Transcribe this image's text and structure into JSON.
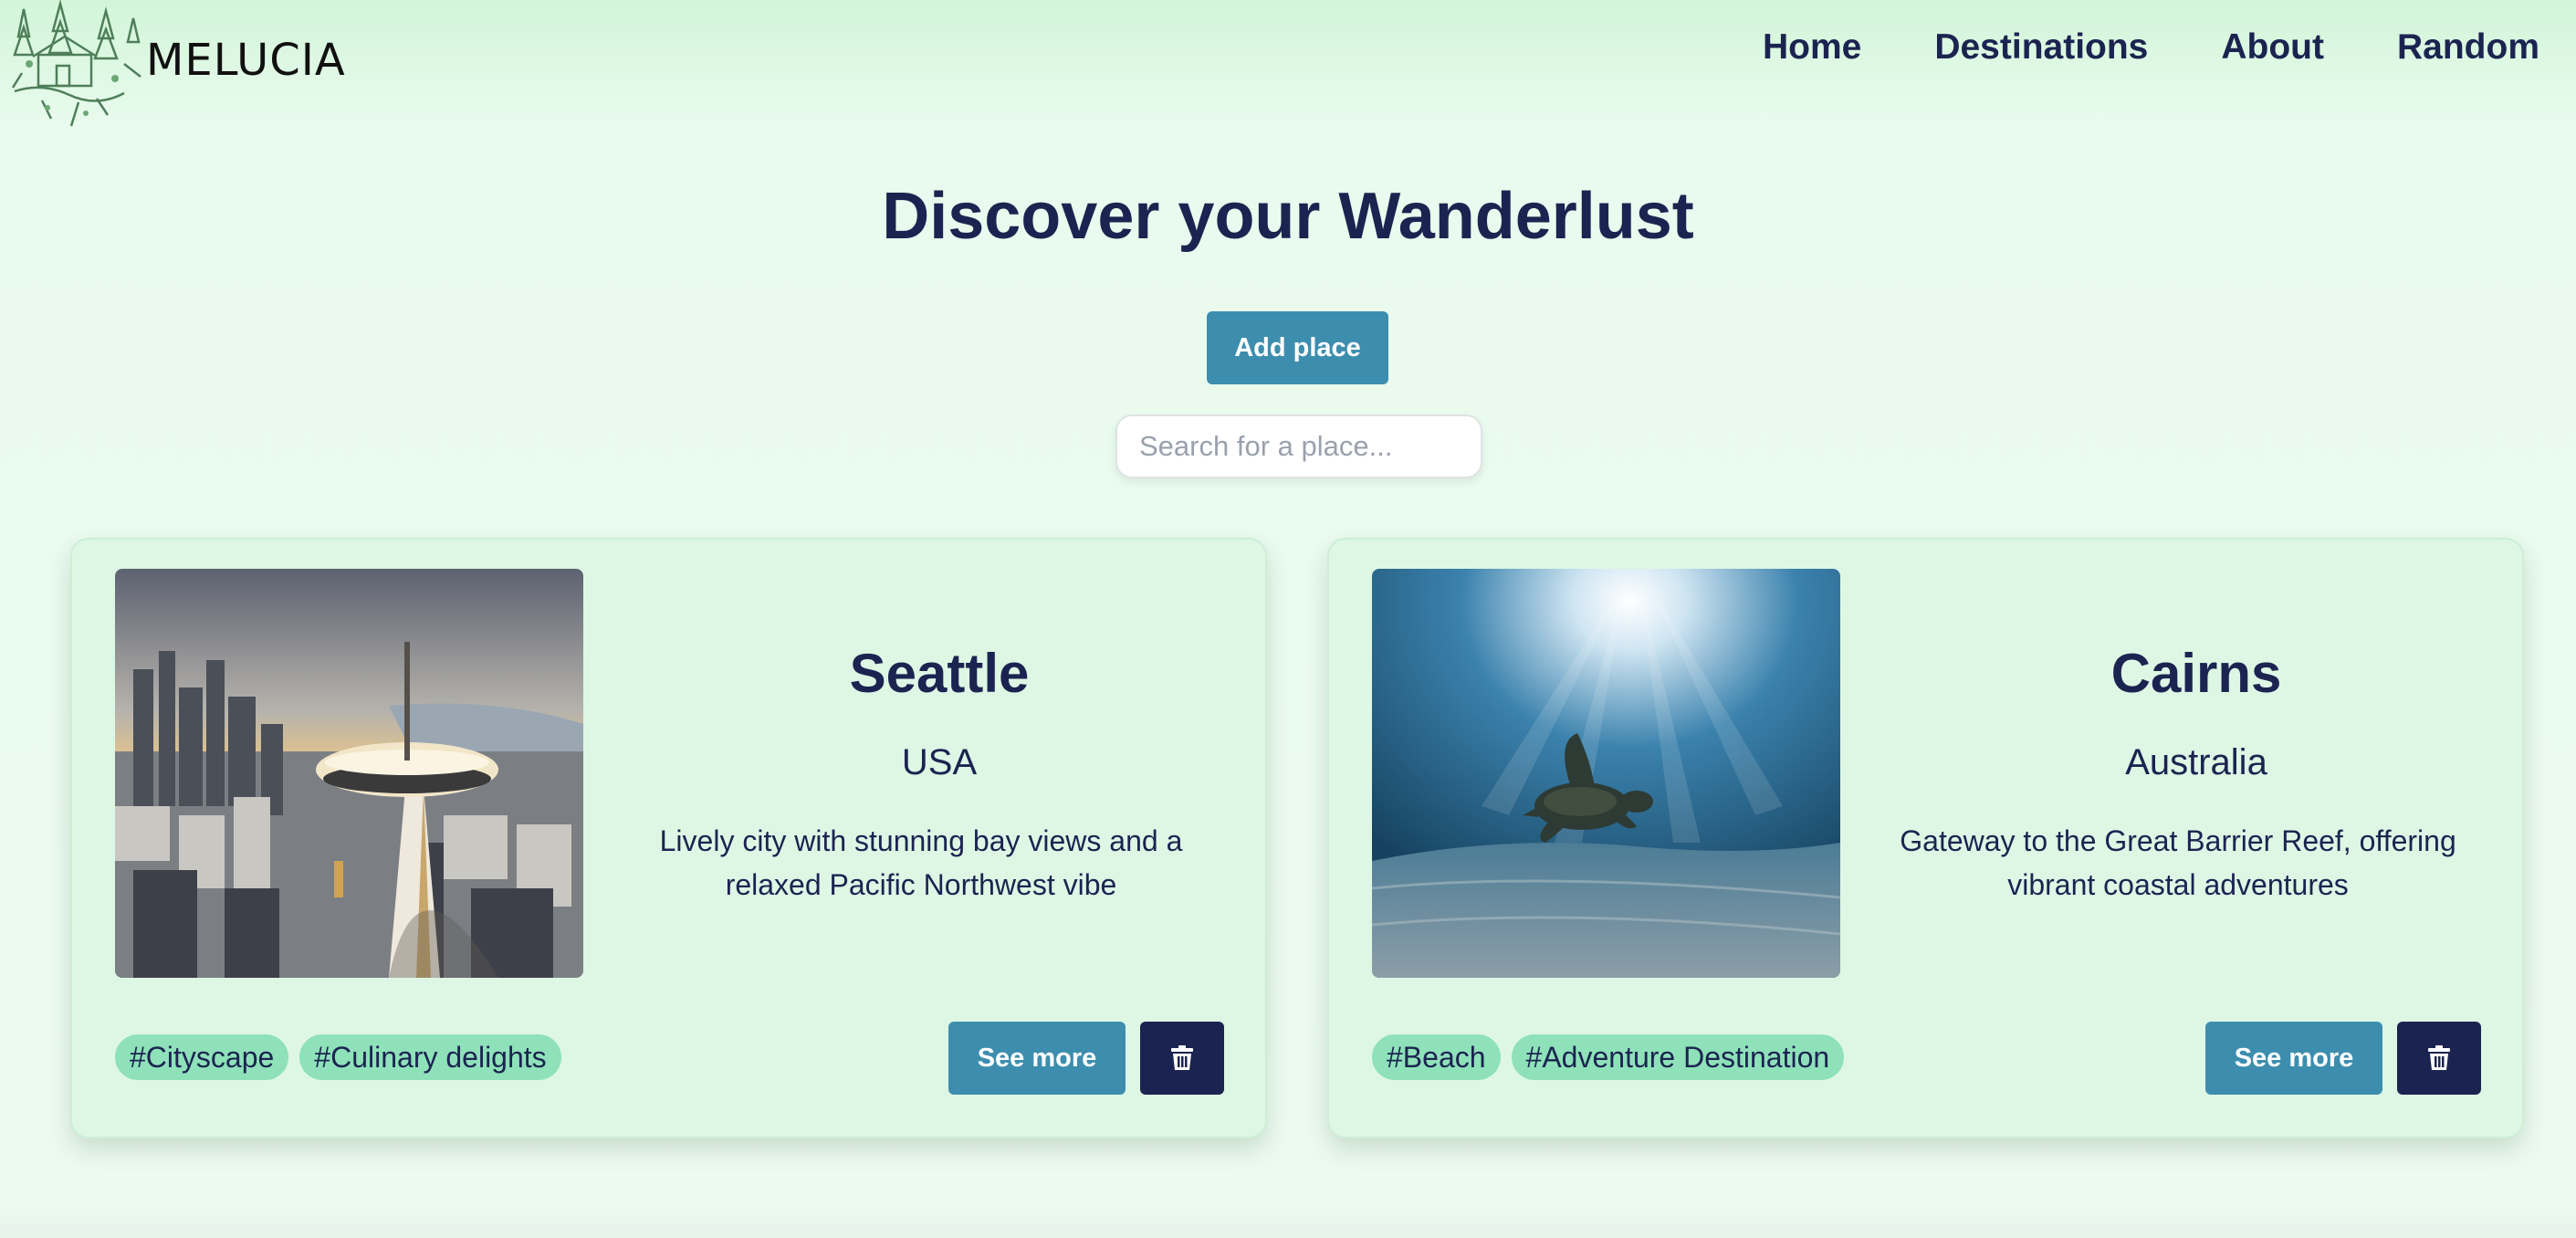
{
  "brand": {
    "name": "MELUCIA",
    "logo_icon": "forest-house-logo"
  },
  "nav": {
    "items": [
      {
        "label": "Home"
      },
      {
        "label": "Destinations"
      },
      {
        "label": "About"
      },
      {
        "label": "Random"
      }
    ]
  },
  "hero": {
    "title": "Discover your Wanderlust",
    "add_button_label": "Add place",
    "search_placeholder": "Search for a place..."
  },
  "colors": {
    "primary_button": "#3d8eae",
    "dark_button": "#1b2450",
    "tag_bg": "#8ee1b9",
    "card_bg": "#def7e5"
  },
  "cards": [
    {
      "name": "Seattle",
      "country": "USA",
      "description": "Lively city with stunning bay views and a relaxed Pacific Northwest vibe",
      "tags": [
        "#Cityscape",
        "#Culinary delights"
      ],
      "see_more_label": "See more",
      "delete_icon": "trash-icon",
      "photo": "space-needle-skyline"
    },
    {
      "name": "Cairns",
      "country": "Australia",
      "description": "Gateway to the Great Barrier Reef, offering vibrant coastal adventures",
      "tags": [
        "#Beach",
        "#Adventure Destination"
      ],
      "see_more_label": "See more",
      "delete_icon": "trash-icon",
      "photo": "sea-turtle-underwater"
    }
  ]
}
